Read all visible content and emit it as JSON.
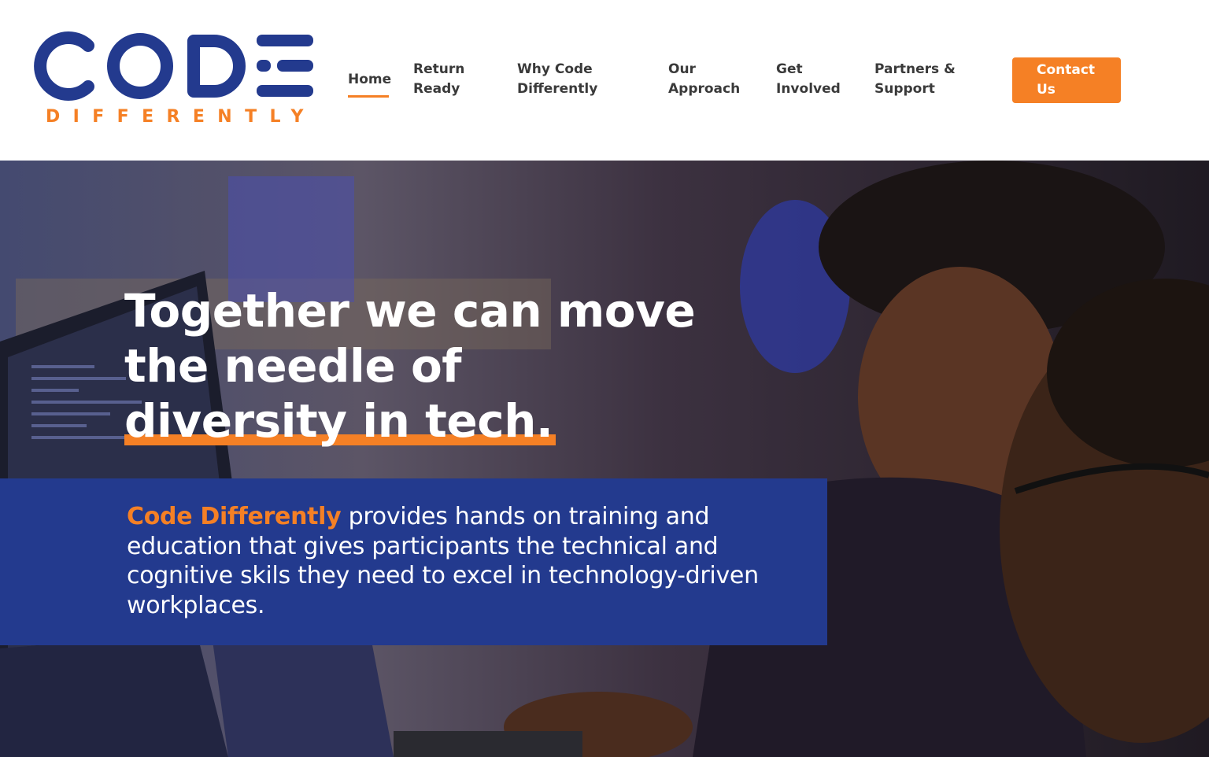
{
  "brand": {
    "logo_main": "CODE",
    "logo_sub": "DIFFERENTLY",
    "primary_color": "#233a8e",
    "accent_color": "#f58025"
  },
  "nav": {
    "items": [
      {
        "label": "Home",
        "active": true
      },
      {
        "label": "Return Ready"
      },
      {
        "label": "Why Code Differently"
      },
      {
        "label": "Our Approach"
      },
      {
        "label": "Get Involved"
      },
      {
        "label": "Partners & Support"
      }
    ],
    "contact_label": "Contact Us"
  },
  "hero": {
    "headline_line1": "Together we can move",
    "headline_line2": "the needle of",
    "headline_line3": "diversity in tech.",
    "description_brand": "Code Differently",
    "description_rest": " provides hands on training and education that gives participants the technical and cognitive skils they need to excel in technology-driven workplaces."
  }
}
